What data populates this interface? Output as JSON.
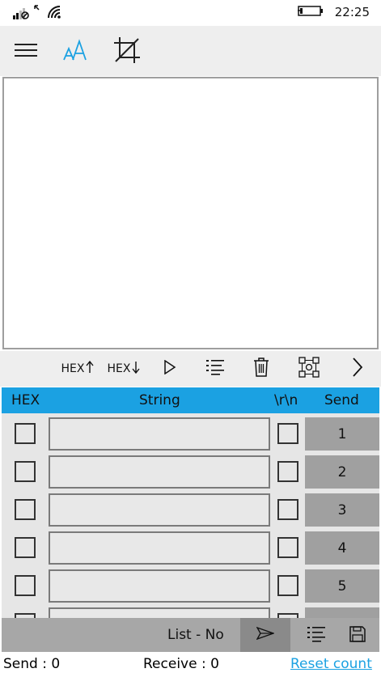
{
  "status_bar": {
    "time": "22:25"
  },
  "app_bar": {
    "menu_icon": "hamburger-icon",
    "font_icon": "font-size-icon",
    "crop_icon": "crop-icon",
    "accent": "#1ba1e2"
  },
  "toolbar": {
    "hex_up_label": "HEX",
    "hex_down_label": "HEX",
    "play_icon": "play-icon",
    "list_icon": "list-icon",
    "delete_icon": "trash-icon",
    "nodes_icon": "nodes-icon",
    "next_icon": "chevron-right-icon"
  },
  "grid": {
    "headers": {
      "hex": "HEX",
      "string": "String",
      "crlf": "\\r\\n",
      "send": "Send"
    },
    "rows": [
      {
        "send_label": "1",
        "value": ""
      },
      {
        "send_label": "2",
        "value": ""
      },
      {
        "send_label": "3",
        "value": ""
      },
      {
        "send_label": "4",
        "value": ""
      },
      {
        "send_label": "5",
        "value": ""
      },
      {
        "send_label": "",
        "value": ""
      }
    ]
  },
  "bottom_bar": {
    "list_label": "List - No"
  },
  "footer": {
    "send_label": "Send : 0",
    "receive_label": "Receive : 0",
    "reset_label": "Reset count"
  },
  "colors": {
    "header_bg": "#1ba1e2",
    "bar_bg": "#eeeeee",
    "send_btn": "#a0a0a0"
  }
}
